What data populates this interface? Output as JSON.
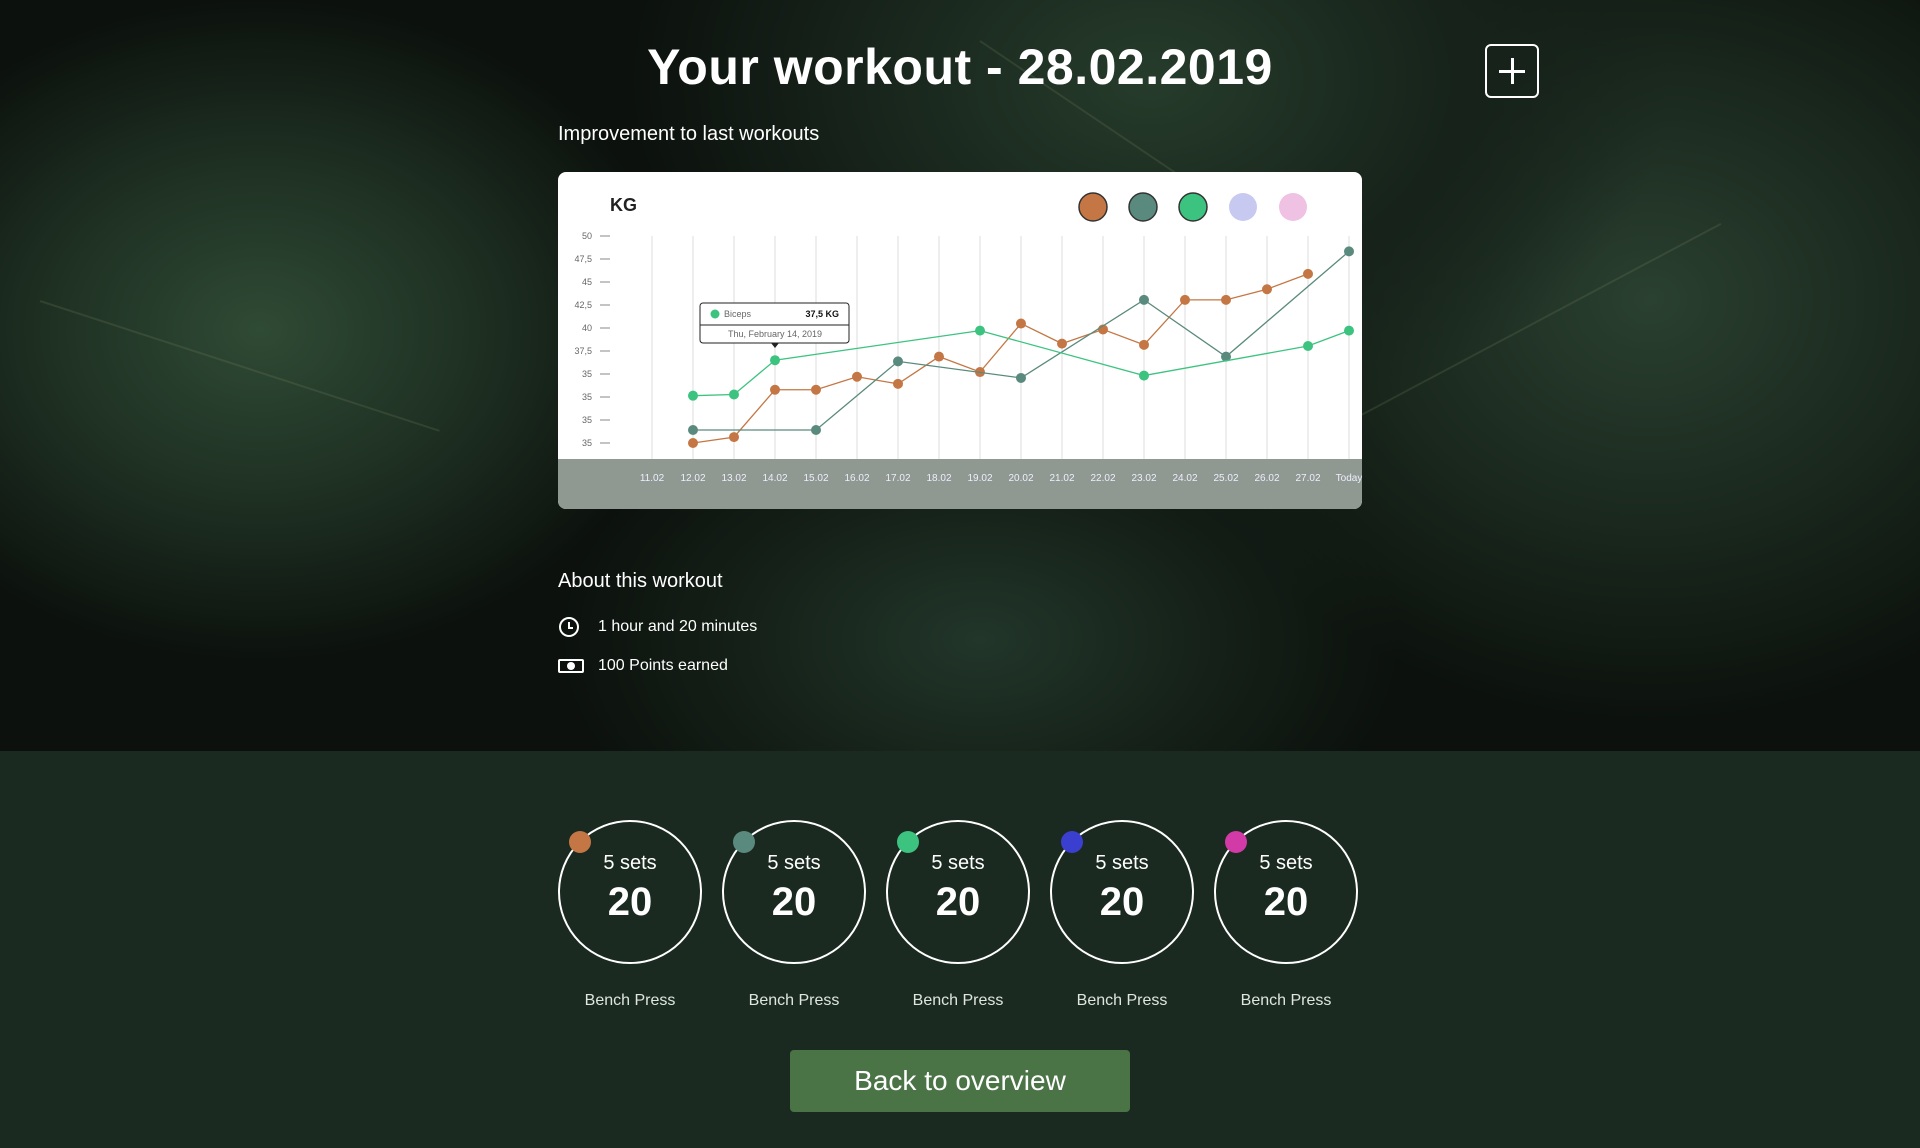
{
  "header": {
    "title": "Your workout - 28.02.2019",
    "add_icon": "plus-icon"
  },
  "chart_section": {
    "subtitle": "Improvement to last workouts"
  },
  "chart_data": {
    "type": "line",
    "ylabel": "KG",
    "y_tick_labels": [
      "50",
      "47,5",
      "45",
      "42,5",
      "40",
      "37,5",
      "35",
      "35",
      "35",
      "35"
    ],
    "ylim": [
      32.5,
      50
    ],
    "categories": [
      "11.02",
      "12.02",
      "13.02",
      "14.02",
      "15.02",
      "16.02",
      "17.02",
      "18.02",
      "19.02",
      "20.02",
      "21.02",
      "22.02",
      "23.02",
      "24.02",
      "25.02",
      "26.02",
      "27.02",
      "Today"
    ],
    "legend_colors": [
      "#c47744",
      "#5a8a7d",
      "#3cc37f",
      "#c8c9f0",
      "#efc1e2"
    ],
    "grid": "vertical",
    "series": [
      {
        "color": "#c47744",
        "values": [
          null,
          32.5,
          33.0,
          37.0,
          37.0,
          38.1,
          37.5,
          39.8,
          38.5,
          42.6,
          40.9,
          42.1,
          40.8,
          44.6,
          44.6,
          45.5,
          46.8,
          null
        ]
      },
      {
        "color": "#5a8a7d",
        "values": [
          null,
          33.6,
          null,
          null,
          33.6,
          null,
          39.4,
          null,
          null,
          38.0,
          null,
          null,
          44.6,
          null,
          39.8,
          null,
          null,
          48.7
        ]
      },
      {
        "color": "#3cc37f",
        "values": [
          null,
          36.5,
          36.6,
          39.5,
          null,
          null,
          null,
          null,
          42.0,
          null,
          null,
          null,
          38.2,
          null,
          null,
          null,
          40.7,
          42.0
        ]
      }
    ],
    "tooltip": {
      "series": "Biceps",
      "value": "37,5 KG",
      "date": "Thu, February 14, 2019",
      "color": "#3cc37f",
      "category_index": 3
    }
  },
  "about": {
    "title": "About this workout",
    "duration_icon": "clock-icon",
    "duration": "1 hour and 20 minutes",
    "points_icon": "cash-icon",
    "points": "100 Points earned"
  },
  "exercises": [
    {
      "sets": "5 sets",
      "reps": "20",
      "name": "Bench Press",
      "color": "#c47744"
    },
    {
      "sets": "5 sets",
      "reps": "20",
      "name": "Bench Press",
      "color": "#5a8a7d"
    },
    {
      "sets": "5 sets",
      "reps": "20",
      "name": "Bench Press",
      "color": "#3cc37f"
    },
    {
      "sets": "5 sets",
      "reps": "20",
      "name": "Bench Press",
      "color": "#3a3fcf"
    },
    {
      "sets": "5 sets",
      "reps": "20",
      "name": "Bench Press",
      "color": "#d23aa8"
    }
  ],
  "back_button": {
    "label": "Back to overview"
  }
}
